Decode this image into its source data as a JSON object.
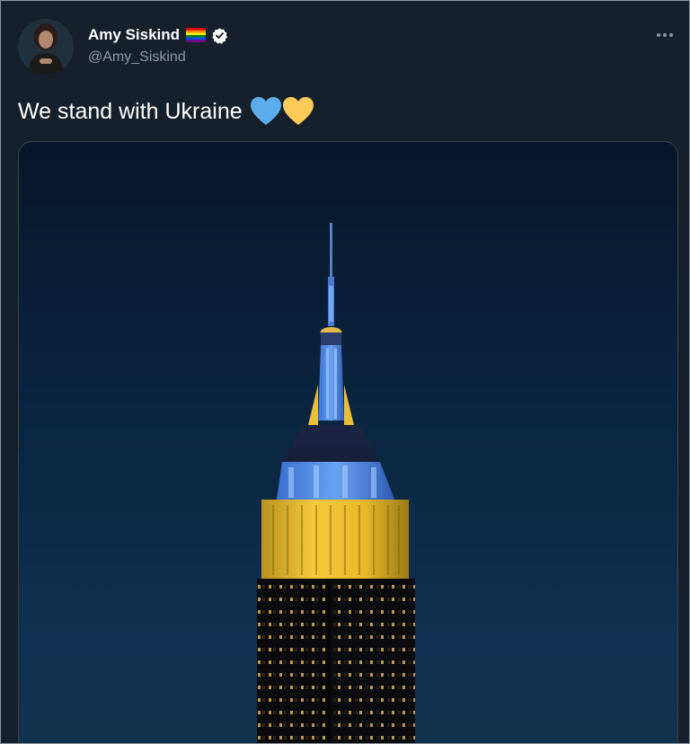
{
  "tweet": {
    "author": {
      "display_name": "Amy Siskind",
      "handle": "@Amy_Siskind",
      "avatar_icon": "avatar-photo",
      "flag_icon": "rainbow-flag-icon",
      "verified_icon": "verified-badge-icon"
    },
    "more_icon": "more-options-icon",
    "text": "We stand with Ukraine",
    "emojis": [
      "blue-heart-icon",
      "yellow-heart-icon"
    ],
    "media": {
      "subject": "empire-state-building-photo",
      "lighting_colors": {
        "blue": "#4a86e8",
        "yellow": "#f2c230"
      }
    }
  },
  "theme": {
    "background": "#15202b",
    "text_primary": "#ffffff",
    "text_secondary": "#8b98a5",
    "border": "#38444d"
  }
}
